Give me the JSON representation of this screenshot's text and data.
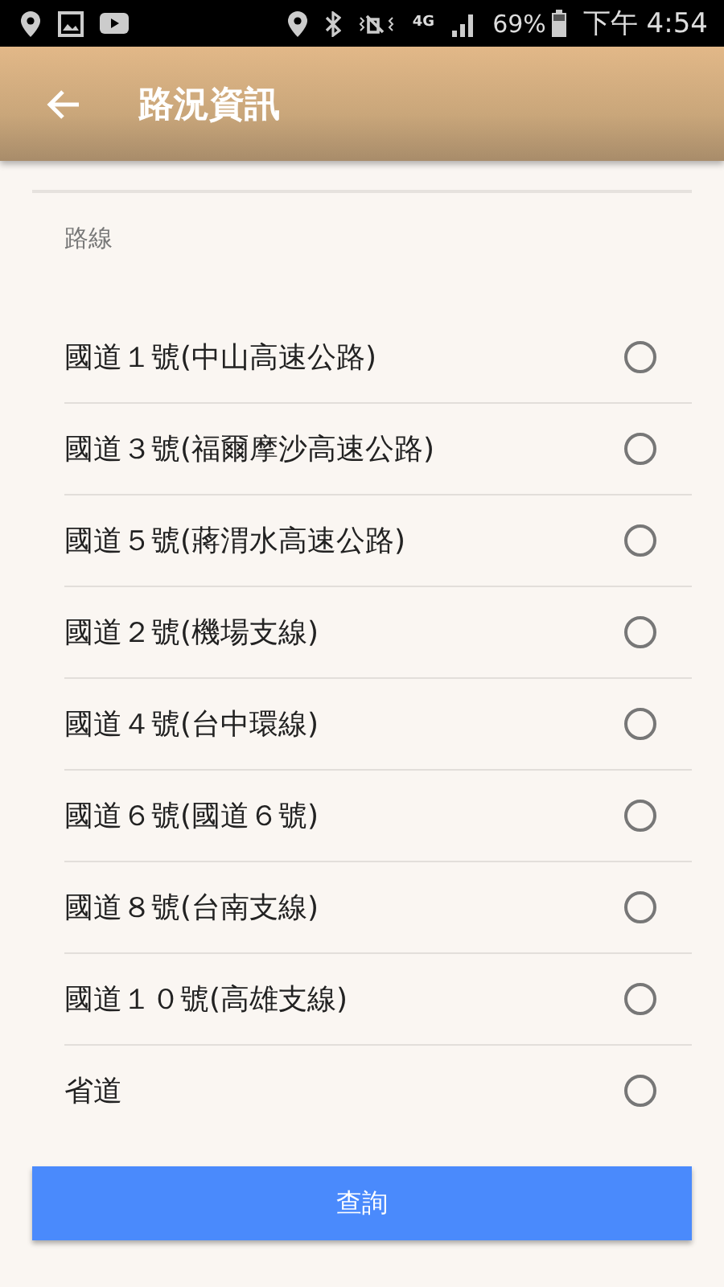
{
  "status_bar": {
    "network": "4G",
    "battery": "69%",
    "time": "下午 4:54"
  },
  "app_bar": {
    "title": "路況資訊"
  },
  "section_label": "路線",
  "routes": [
    {
      "label": "國道１號(中山高速公路)",
      "selected": false
    },
    {
      "label": "國道３號(福爾摩沙高速公路)",
      "selected": false
    },
    {
      "label": "國道５號(蔣渭水高速公路)",
      "selected": false
    },
    {
      "label": "國道２號(機場支線)",
      "selected": false
    },
    {
      "label": "國道４號(台中環線)",
      "selected": false
    },
    {
      "label": "國道６號(國道６號)",
      "selected": false
    },
    {
      "label": "國道８號(台南支線)",
      "selected": false
    },
    {
      "label": "國道１０號(高雄支線)",
      "selected": false
    },
    {
      "label": "省道",
      "selected": false
    }
  ],
  "button": "查詢"
}
